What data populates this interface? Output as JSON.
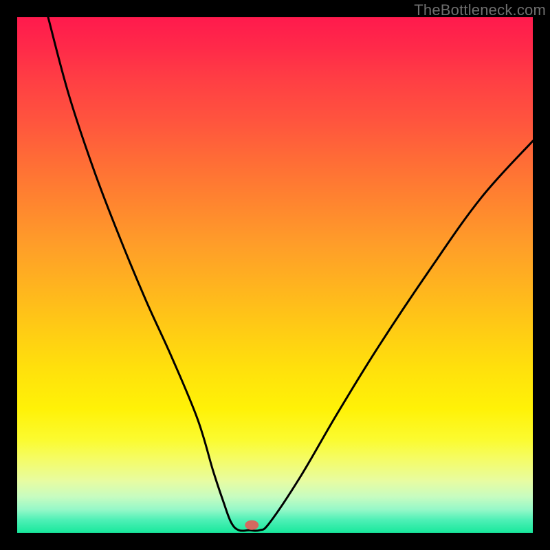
{
  "watermark": "TheBottleneck.com",
  "chart_data": {
    "type": "line",
    "title": "",
    "xlabel": "",
    "ylabel": "",
    "xlim": [
      0,
      100
    ],
    "ylim": [
      0,
      100
    ],
    "grid": false,
    "series": [
      {
        "name": "curve",
        "x": [
          6,
          10,
          15,
          20,
          25,
          30,
          35,
          38,
          40,
          41.5,
          43,
          45,
          47,
          49,
          55,
          62,
          70,
          80,
          90,
          100
        ],
        "values": [
          100,
          85,
          70,
          57,
          45,
          34,
          22,
          12,
          6,
          2,
          0.5,
          0.5,
          0.5,
          2,
          11,
          23,
          36,
          51,
          65,
          76
        ]
      }
    ],
    "marker": {
      "x": 45.5,
      "y": 1.5,
      "color": "#d4695f",
      "rx": 10,
      "ry": 7
    },
    "background_gradient_stops": [
      {
        "pos": 0,
        "color": "#ff1a4d"
      },
      {
        "pos": 50,
        "color": "#ffb31f"
      },
      {
        "pos": 80,
        "color": "#fff207"
      },
      {
        "pos": 100,
        "color": "#18e89c"
      }
    ]
  }
}
